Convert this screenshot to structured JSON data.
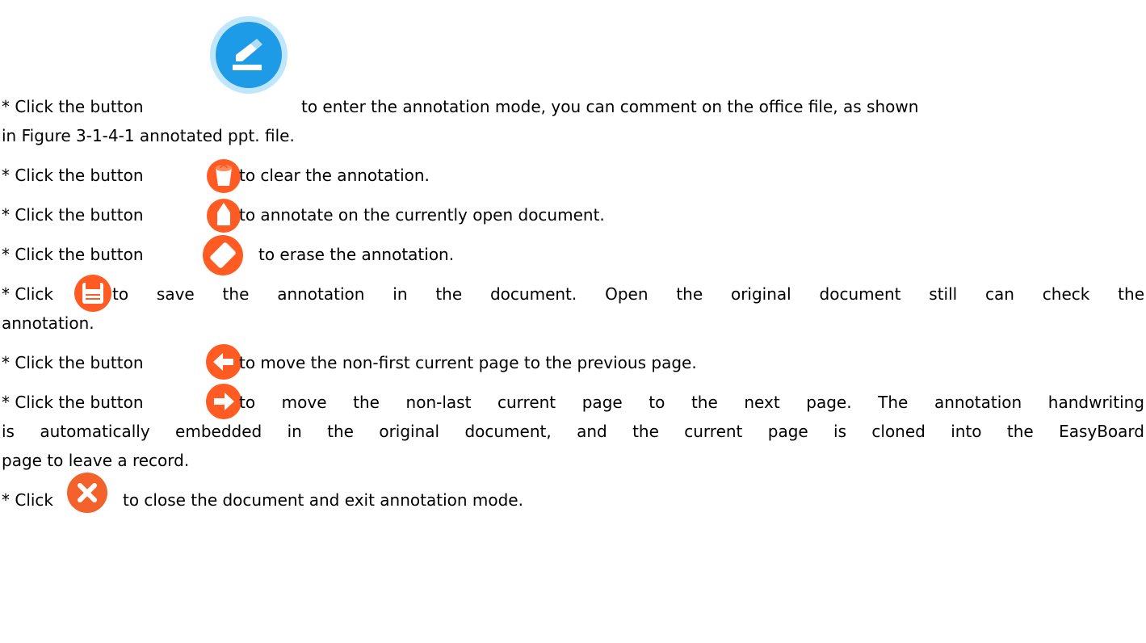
{
  "lines": {
    "l1a": "* Click the button",
    "l1b": "to enter the annotation mode, you can comment on the office file, as shown",
    "l1c": "in Figure 3-1-4-1 annotated ppt. file.",
    "l2a": "* Click the button",
    "l2b": "to clear the annotation.",
    "l3a": "* Click the button",
    "l3b": "to annotate on the currently open document.",
    "l4a": "* Click the button",
    "l4b": "to erase the annotation.",
    "l5a": "* Click",
    "l5b": "to save the annotation in the document. Open the original document still can check the",
    "l5c": "annotation.",
    "l6a": "* Click the button",
    "l6b": "to move the non-first current page to the previous page.",
    "l7a": "* Click the button",
    "l7b": "to move the non-last current page to the next page. The annotation handwriting",
    "l7c": "is automatically embedded in the original document, and the current page is cloned into the EasyBoard",
    "l7d": "page to leave a record.",
    "l8a": "* Click",
    "l8b": "to close the document and exit annotation mode."
  },
  "icons": {
    "annotation_mode": "pencil-icon",
    "clear": "trash-icon",
    "annotate": "highlighter-icon",
    "erase": "eraser-icon",
    "save": "floppy-disk-icon",
    "previous": "arrow-left-icon",
    "next": "arrow-right-icon",
    "close": "close-icon"
  },
  "colors": {
    "annotation_blue": "#1e9be6",
    "annotation_blue_light": "#bfe6fb",
    "tool_orange": "#ff5b22",
    "close_orange": "#f3622a"
  }
}
